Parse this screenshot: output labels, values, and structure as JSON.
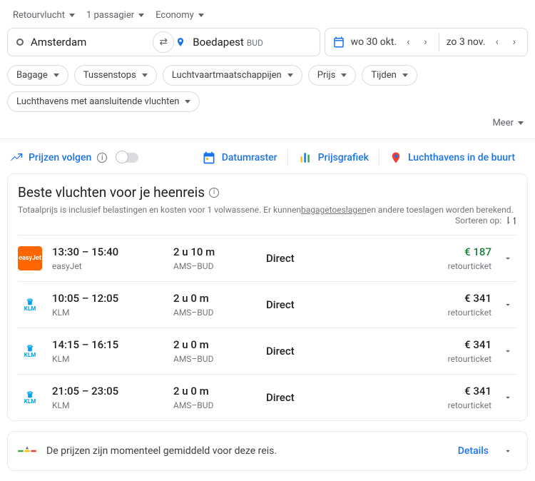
{
  "options": {
    "trip": "Retourvlucht",
    "pax": "1 passagier",
    "cabin": "Economy"
  },
  "od": {
    "origin": "Amsterdam",
    "destination": "Boedapest",
    "dest_code": "BUD"
  },
  "dates": {
    "depart": "wo 30 okt.",
    "return": "zo 3 nov."
  },
  "filters": [
    "Bagage",
    "Tussenstops",
    "Luchtvaartmaatschappijen",
    "Prijs",
    "Tijden",
    "Luchthavens met aansluitende vluchten"
  ],
  "more": "Meer",
  "track": "Prijzen volgen",
  "tools": {
    "grid": "Datumraster",
    "graph": "Prijsgrafiek",
    "nearby": "Luchthavens in de buurt"
  },
  "results": {
    "title": "Beste vluchten voor je heenreis",
    "sub1": "Totaalprijs is inclusief belastingen en kosten voor 1 volwassene. Er kunnen ",
    "sub_link": "bagagetoeslagen",
    "sub2": " en andere toeslagen worden berekend.",
    "sort": "Sorteren op:"
  },
  "flights": [
    {
      "logo": "ej",
      "logolabel": "easyJet",
      "times": "13:30 – 15:40",
      "airline": "easyJet",
      "duration": "2 u 10 m",
      "route": "AMS–BUD",
      "stops": "Direct",
      "price": "€ 187",
      "ticket": "retourticket",
      "best": true
    },
    {
      "logo": "klm",
      "logolabel": "KLM",
      "times": "10:05 – 12:05",
      "airline": "KLM",
      "duration": "2 u 0 m",
      "route": "AMS–BUD",
      "stops": "Direct",
      "price": "€ 341",
      "ticket": "retourticket",
      "best": false
    },
    {
      "logo": "klm",
      "logolabel": "KLM",
      "times": "14:15 – 16:15",
      "airline": "KLM",
      "duration": "2 u 0 m",
      "route": "AMS–BUD",
      "stops": "Direct",
      "price": "€ 341",
      "ticket": "retourticket",
      "best": false
    },
    {
      "logo": "klm",
      "logolabel": "KLM",
      "times": "21:05 – 23:05",
      "airline": "KLM",
      "duration": "2 u 0 m",
      "route": "AMS–BUD",
      "stops": "Direct",
      "price": "€ 341",
      "ticket": "retourticket",
      "best": false
    }
  ],
  "insight": "De prijzen zijn momenteel gemiddeld voor deze reis.",
  "details": "Details"
}
